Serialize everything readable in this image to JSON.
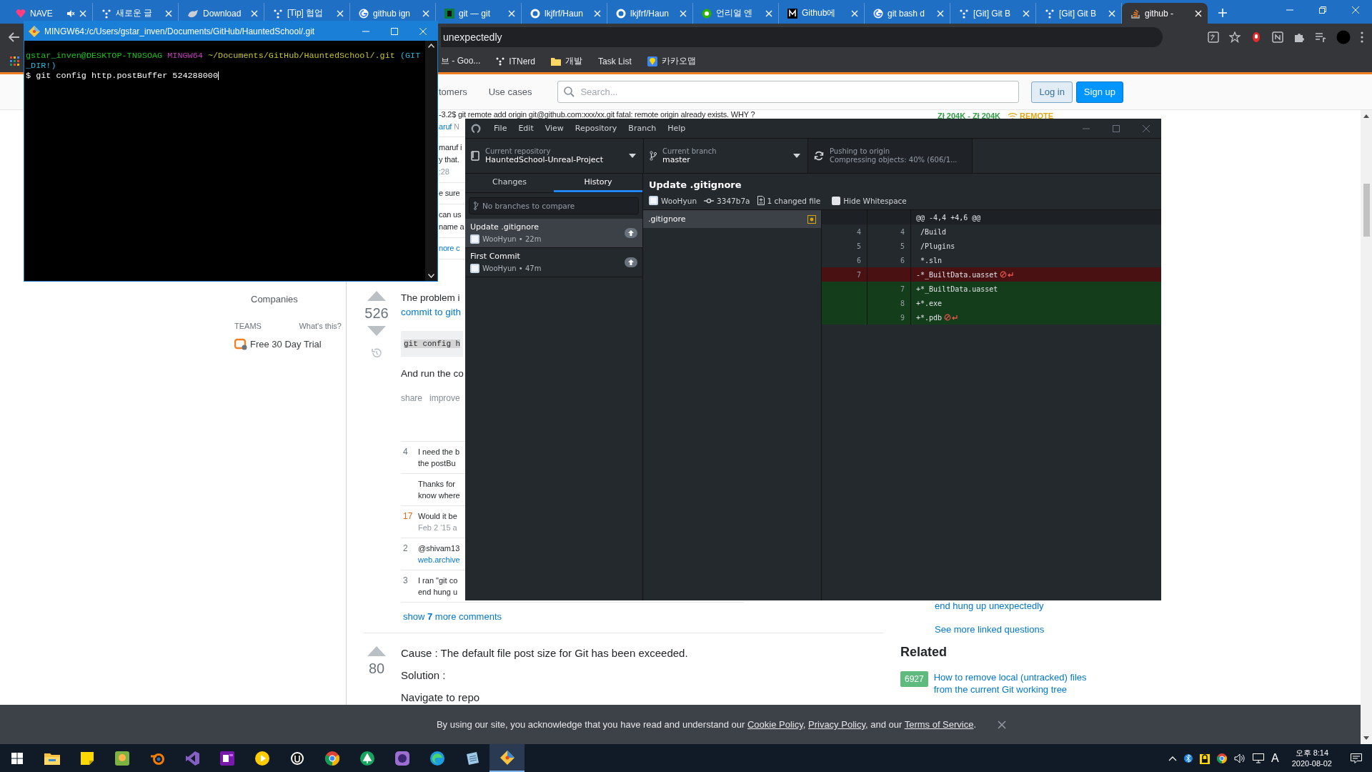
{
  "browser": {
    "tabs": [
      {
        "title": "NAVE",
        "kind": "heart",
        "muted": true,
        "selected": false
      },
      {
        "title": "새로운 글",
        "kind": "dots",
        "muted": false,
        "selected": false
      },
      {
        "title": "Download",
        "kind": "animal",
        "muted": false,
        "selected": false
      },
      {
        "title": "[Tip] 협업",
        "kind": "dots",
        "muted": false,
        "selected": false
      },
      {
        "title": "github ign",
        "kind": "google",
        "muted": false,
        "selected": false
      },
      {
        "title": "git — git",
        "kind": "square",
        "muted": false,
        "selected": false
      },
      {
        "title": "lkjfrf/Haun",
        "kind": "github",
        "muted": false,
        "selected": false
      },
      {
        "title": "lkjfrf/Haun",
        "kind": "github",
        "muted": false,
        "selected": false
      },
      {
        "title": "언리얼 엔",
        "kind": "chat",
        "muted": false,
        "selected": false
      },
      {
        "title": "Github에",
        "kind": "medium",
        "muted": false,
        "selected": false
      },
      {
        "title": "git bash d",
        "kind": "google",
        "muted": false,
        "selected": false
      },
      {
        "title": "[Git] Git B",
        "kind": "dots",
        "muted": false,
        "selected": false
      },
      {
        "title": "[Git] Git B",
        "kind": "dots",
        "muted": false,
        "selected": false
      },
      {
        "title": "github -",
        "kind": "stack",
        "muted": false,
        "selected": true
      }
    ],
    "address": {
      "value": "unexpectedly"
    },
    "bookmarks": [
      {
        "label": "브 - Goo...",
        "kind": "text"
      },
      {
        "label": "ITNerd",
        "kind": "dots"
      },
      {
        "label": "개발",
        "kind": "folder"
      },
      {
        "label": "Task List",
        "kind": "text"
      },
      {
        "label": "카카오맵",
        "kind": "pin"
      }
    ]
  },
  "page": {
    "header": {
      "nav": [
        "tomers",
        "Use cases"
      ],
      "search": {
        "placeholder": "Search..."
      },
      "buttons": [
        {
          "label": "Log in",
          "kind": "secondary"
        },
        {
          "label": "Sign up",
          "kind": "primary"
        }
      ]
    },
    "sidebar": {
      "companies": "Companies",
      "teams": "TEAMS",
      "whats_this": "What's this?",
      "trial": "Free 30 Day Trial"
    },
    "fragments": [
      {
        "lines": [
          [
            {
              "text": "-3.2$ git remote add origin git@github.com:xxx/xx.git fatal: remote origin already exists. WHY ?",
              "kind": "text"
            }
          ],
          [
            {
              "text": "aruf",
              "kind": "link"
            },
            {
              "text": "N",
              "kind": "meta"
            }
          ]
        ]
      },
      {
        "lines": [
          [
            {
              "text": "maruf i",
              "kind": "text"
            }
          ],
          [
            {
              "text": "y that.",
              "kind": "text"
            }
          ],
          [
            {
              "text": ":28",
              "kind": "meta"
            }
          ]
        ]
      },
      {
        "lines": [
          [
            {
              "text": "e sure",
              "kind": "text"
            }
          ]
        ]
      },
      {
        "lines": [
          [
            {
              "text": "can us",
              "kind": "text"
            }
          ],
          [
            {
              "text": "name a",
              "kind": "text"
            }
          ]
        ]
      },
      {
        "lines": [
          [
            {
              "text": "nore c",
              "kind": "link"
            }
          ]
        ]
      }
    ],
    "question": {
      "votes": "526",
      "lines": [
        {
          "text": "The problem i",
          "kind": "text"
        },
        {
          "text": "commit to gith",
          "kind": "link"
        }
      ],
      "code": "git config h",
      "after": "And run the co",
      "actions": [
        "share",
        "improve"
      ]
    },
    "comments": [
      {
        "score": "4",
        "hot": false,
        "lines": [
          [
            {
              "text": "I need the b",
              "kind": "text"
            }
          ],
          [
            {
              "text": "the postBu",
              "kind": "text"
            }
          ]
        ]
      },
      {
        "lines": [
          [
            {
              "text": "Thanks for",
              "kind": "text"
            }
          ],
          [
            {
              "text": "know where",
              "kind": "text"
            }
          ]
        ]
      },
      {
        "score": "17",
        "hot": true,
        "lines": [
          [
            {
              "text": "Would it be",
              "kind": "text"
            }
          ],
          [
            {
              "text": "Feb 2 '15 a",
              "kind": "meta"
            }
          ]
        ]
      },
      {
        "score": "2",
        "hot": false,
        "lines": [
          [
            {
              "text": "@shivam13",
              "kind": "text"
            }
          ],
          [
            {
              "text": "web.archive",
              "kind": "link"
            }
          ]
        ]
      },
      {
        "score": "3",
        "hot": false,
        "lines": [
          [
            {
              "text": "I ran \"git co",
              "kind": "text"
            }
          ],
          [
            {
              "text": "end hung u",
              "kind": "text"
            }
          ]
        ]
      }
    ],
    "show_more": "show **7** more comments",
    "answer": {
      "votes": "80",
      "paragraphs": [
        "Cause : The default file post size for Git has been exceeded.",
        "Solution :",
        "Navigate to repo"
      ]
    },
    "right": {
      "salary": "Zł 204K - Zł 204K",
      "remote": "REMOTE",
      "linked": [
        "end hung up unexpectedly",
        "See more linked questions"
      ],
      "related_title": "Related",
      "related": [
        {
          "count": "6927",
          "title": "How to remove local (untracked) files from the current Git working tree"
        }
      ]
    }
  },
  "cookie_notice": [
    {
      "text": "By using our site, you acknowledge that you have read and understand our ",
      "kind": "text"
    },
    {
      "text": "Cookie Policy",
      "kind": "link"
    },
    {
      "text": ", ",
      "kind": "text"
    },
    {
      "text": "Privacy Policy",
      "kind": "link"
    },
    {
      "text": ", and our ",
      "kind": "text"
    },
    {
      "text": "Terms of Service",
      "kind": "link"
    },
    {
      "text": ".",
      "kind": "text"
    }
  ],
  "terminal": {
    "title": "MINGW64:/c/Users/gstar_inven/Documents/GitHub/HauntedSchool/.git",
    "prompt": [
      {
        "text": "gstar_inven@DESKTOP-TN9SOAG",
        "kind": "user"
      },
      {
        "text": "MINGW64",
        "kind": "system"
      },
      {
        "text": "~/Documents/GitHub/HauntedSchool/.git",
        "kind": "path"
      },
      {
        "text": "(GIT_DIR!)",
        "kind": "branch"
      }
    ],
    "command": "$ git config http.postBuffer 524288000"
  },
  "github_desktop": {
    "menu": [
      "File",
      "Edit",
      "View",
      "Repository",
      "Branch",
      "Help"
    ],
    "toolbar": [
      {
        "kind": "repository",
        "label": "Current repository",
        "value": "HauntedSchool-Unreal-Project"
      },
      {
        "kind": "branch",
        "label": "Current branch",
        "value": "master"
      },
      {
        "kind": "push",
        "label": "Pushing to origin",
        "value": "Compressing objects: 40% (606/1..."
      }
    ],
    "tabs": [
      {
        "label": "Changes",
        "selected": false
      },
      {
        "label": "History",
        "selected": true
      }
    ],
    "filter": {
      "placeholder": "No branches to compare"
    },
    "commits": [
      {
        "title": "Update .gitignore",
        "meta": "WooHyun • 22m",
        "selected": true
      },
      {
        "title": "First Commit",
        "meta": "WooHyun • 47m",
        "selected": false
      }
    ],
    "commit": {
      "title": "Update .gitignore",
      "author": "WooHyun",
      "sha": "3347b7a",
      "files_changed": "1 changed file",
      "hide_whitespace": {
        "label": "Hide Whitespace",
        "checked": false
      }
    },
    "files": [
      {
        "name": ".gitignore",
        "selected": true,
        "kind": "modified"
      }
    ],
    "diff": {
      "hunk": "@@ -4,4 +4,6 @@",
      "lines": [
        {
          "kind": "context",
          "old": "4",
          "new": "4",
          "text": " /Build",
          "no_newline": false
        },
        {
          "kind": "context",
          "old": "5",
          "new": "5",
          "text": " /Plugins",
          "no_newline": false
        },
        {
          "kind": "context",
          "old": "6",
          "new": "6",
          "text": " *.sln",
          "no_newline": false
        },
        {
          "kind": "deleted",
          "old": "7",
          "text": "-*_BuiltData.uasset",
          "no_newline": true
        },
        {
          "kind": "added",
          "new": "7",
          "text": "+*_BuiltData.uasset",
          "no_newline": false
        },
        {
          "kind": "added",
          "new": "8",
          "text": "+*.exe",
          "no_newline": false
        },
        {
          "kind": "added",
          "new": "9",
          "text": "+*.pdb",
          "no_newline": true
        }
      ]
    }
  },
  "taskbar": {
    "apps": [
      {
        "kind": "folder",
        "selected": false
      },
      {
        "kind": "note",
        "selected": false
      },
      {
        "kind": "map",
        "selected": false
      },
      {
        "kind": "blender",
        "selected": false
      },
      {
        "kind": "vs",
        "selected": false
      },
      {
        "kind": "onenote",
        "selected": false
      },
      {
        "kind": "play",
        "selected": false
      },
      {
        "kind": "ring",
        "selected": false
      },
      {
        "kind": "chrome",
        "selected": false
      },
      {
        "kind": "tree",
        "selected": false
      },
      {
        "kind": "bubble",
        "selected": false
      },
      {
        "kind": "edge",
        "selected": false
      },
      {
        "kind": "pad",
        "selected": false
      },
      {
        "kind": "git",
        "selected": true
      }
    ],
    "ime": "A",
    "time": "오후 8:14",
    "date": "2020-08-02"
  }
}
